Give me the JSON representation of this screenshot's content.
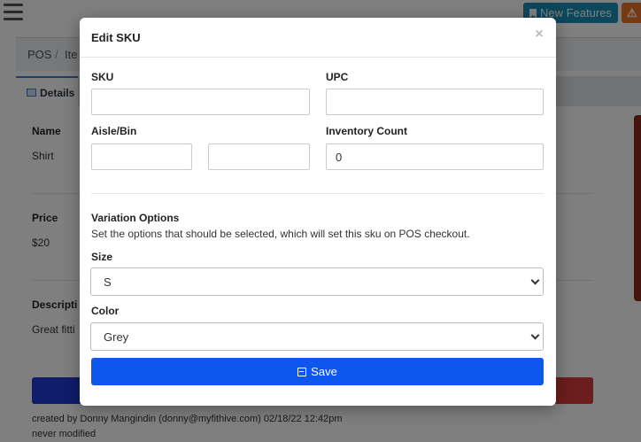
{
  "topbar": {
    "new_features_label": "New Features",
    "warn_label": "⚠"
  },
  "breadcrumb": {
    "root": "POS",
    "separator": "/",
    "current": "Ite"
  },
  "tabs": {
    "details_label": "Details"
  },
  "item": {
    "name_label": "Name",
    "name_value": "Shirt",
    "price_label": "Price",
    "price_value": "$20",
    "description_label": "Descripti",
    "description_value": "Great fitti"
  },
  "footer": {
    "created_by": "created by Donny Mangindin (donny@myfithive.com) 02/18/22 12:42pm",
    "modified": "never modified"
  },
  "modal": {
    "title": "Edit SKU",
    "close_label": "×",
    "sku_label": "SKU",
    "sku_value": "",
    "upc_label": "UPC",
    "upc_value": "",
    "aisle_bin_label": "Aisle/Bin",
    "aisle_value": "",
    "bin_value": "",
    "inventory_label": "Inventory Count",
    "inventory_value": "0",
    "variation_title": "Variation Options",
    "variation_help": "Set the options that should be selected, which will set this sku on POS checkout.",
    "size_label": "Size",
    "size_selected": "S",
    "color_label": "Color",
    "color_selected": "Grey",
    "save_label": "Save"
  },
  "colors": {
    "save_button": "#0d57ec",
    "new_features": "#1a8fb8",
    "warn": "#e8742a",
    "overlay": "rgba(0,0,0,0.5)"
  }
}
